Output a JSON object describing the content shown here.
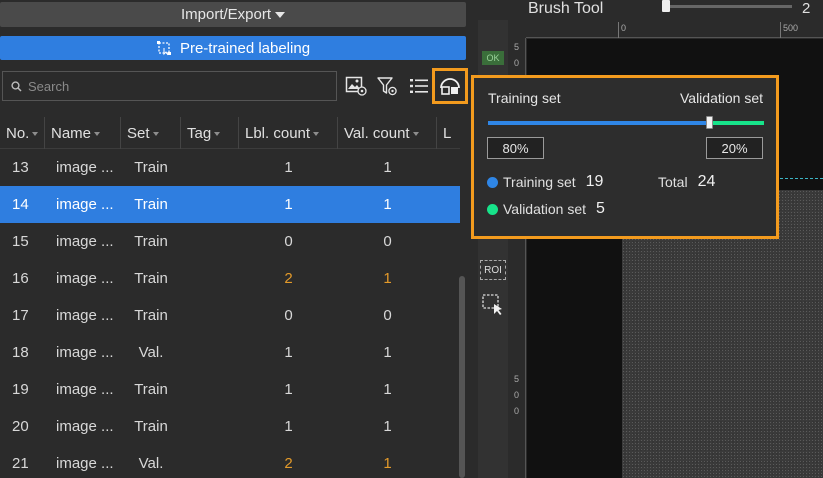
{
  "toolbar": {
    "import_export_label": "Import/Export",
    "pretrained_label": "Pre-trained labeling"
  },
  "search": {
    "placeholder": "Search",
    "value": ""
  },
  "table": {
    "columns": [
      "No.",
      "Name",
      "Set",
      "Tag",
      "Lbl. count",
      "Val. count",
      "L"
    ],
    "rows": [
      {
        "no": "13",
        "name": "image ...",
        "set": "Train",
        "tag": "",
        "lbl": "1",
        "val": "1",
        "highlight": false,
        "selected": false
      },
      {
        "no": "14",
        "name": "image ...",
        "set": "Train",
        "tag": "",
        "lbl": "1",
        "val": "1",
        "highlight": false,
        "selected": true
      },
      {
        "no": "15",
        "name": "image ...",
        "set": "Train",
        "tag": "",
        "lbl": "0",
        "val": "0",
        "highlight": false,
        "selected": false
      },
      {
        "no": "16",
        "name": "image ...",
        "set": "Train",
        "tag": "",
        "lbl": "2",
        "val": "1",
        "highlight": true,
        "selected": false
      },
      {
        "no": "17",
        "name": "image ...",
        "set": "Train",
        "tag": "",
        "lbl": "0",
        "val": "0",
        "highlight": false,
        "selected": false
      },
      {
        "no": "18",
        "name": "image ...",
        "set": "Val.",
        "tag": "",
        "lbl": "1",
        "val": "1",
        "highlight": false,
        "selected": false
      },
      {
        "no": "19",
        "name": "image ...",
        "set": "Train",
        "tag": "",
        "lbl": "1",
        "val": "1",
        "highlight": false,
        "selected": false
      },
      {
        "no": "20",
        "name": "image ...",
        "set": "Train",
        "tag": "",
        "lbl": "1",
        "val": "1",
        "highlight": false,
        "selected": false
      },
      {
        "no": "21",
        "name": "image ...",
        "set": "Val.",
        "tag": "",
        "lbl": "2",
        "val": "1",
        "highlight": true,
        "selected": false
      }
    ]
  },
  "brush": {
    "label": "Brush Tool",
    "value": "2",
    "level_fraction": 0.0
  },
  "side_tools": {
    "ok_label": "OK",
    "roi_label": "ROI"
  },
  "rulers": {
    "top_ticks": [
      "0",
      "500"
    ],
    "left_ticks_top": [
      "5",
      "0"
    ],
    "left_ticks_bottom": [
      "5",
      "0",
      "0"
    ]
  },
  "split_popup": {
    "training_label": "Training set",
    "validation_label": "Validation set",
    "train_fraction": 0.8,
    "train_percent": "80%",
    "val_percent": "20%",
    "training_count_label": "Training set",
    "training_count": "19",
    "validation_count_label": "Validation set",
    "validation_count": "5",
    "total_label": "Total",
    "total": "24"
  },
  "colors": {
    "accent_blue": "#2f7ee0",
    "highlight_orange": "#f39b1e",
    "training_dot": "#2f86e6",
    "validation_dot": "#17e38a",
    "count_orange": "#e39a2a"
  },
  "icons": [
    "search-icon",
    "image-settings-icon",
    "filter-settings-icon",
    "list-icon",
    "dataset-split-icon",
    "pretrained-label-icon",
    "caret-down-icon",
    "rectangle-tool-icon"
  ]
}
